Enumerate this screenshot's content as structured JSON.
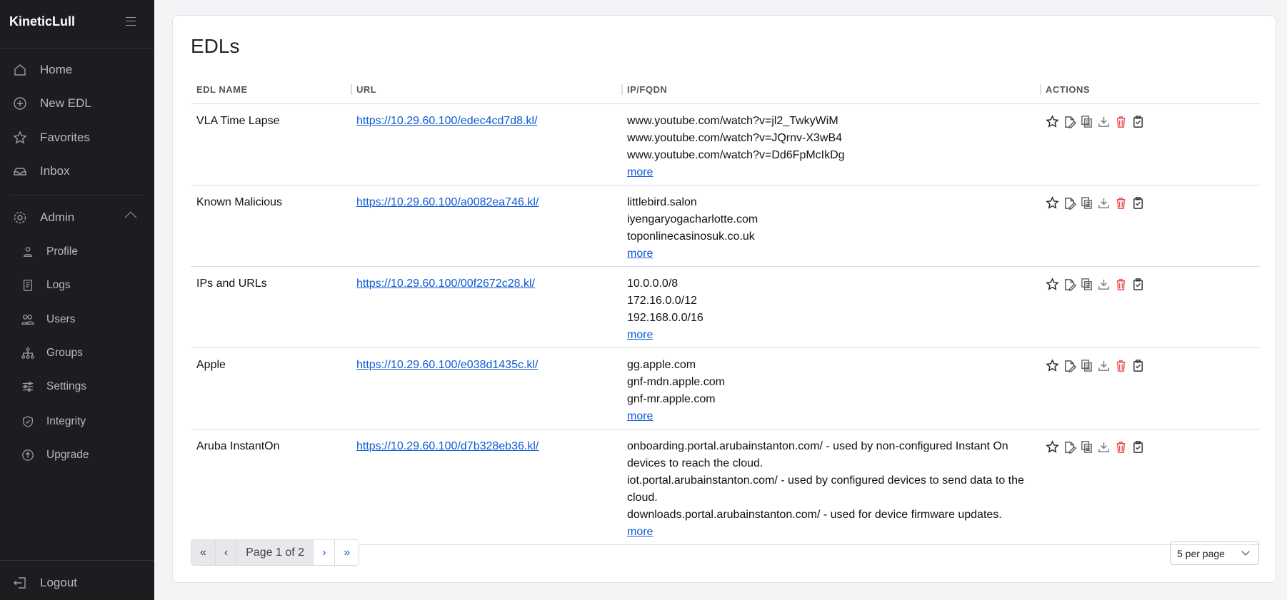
{
  "app": {
    "brand": "KineticLull"
  },
  "sidebar": {
    "items": [
      {
        "label": "Home",
        "icon": "home-icon"
      },
      {
        "label": "New EDL",
        "icon": "plus-circle-icon"
      },
      {
        "label": "Favorites",
        "icon": "star-icon"
      },
      {
        "label": "Inbox",
        "icon": "inbox-icon"
      }
    ],
    "admin": {
      "label": "Admin",
      "icon": "gear-icon"
    },
    "admin_items": [
      {
        "label": "Profile"
      },
      {
        "label": "Logs"
      },
      {
        "label": "Users"
      },
      {
        "label": "Groups"
      },
      {
        "label": "Settings"
      },
      {
        "label": "Integrity"
      },
      {
        "label": "Upgrade"
      }
    ],
    "logout": "Logout"
  },
  "main": {
    "title": "EDLs",
    "columns": [
      "EDL NAME",
      "URL",
      "IP/FQDN",
      "ACTIONS"
    ],
    "more_label": "more",
    "rows": [
      {
        "name": "VLA Time Lapse",
        "url": "https://10.29.60.100/edec4cd7d8.kl/",
        "entries": [
          "www.youtube.com/watch?v=jl2_TwkyWiM",
          "www.youtube.com/watch?v=JQrnv-X3wB4",
          "www.youtube.com/watch?v=Dd6FpMcIkDg"
        ]
      },
      {
        "name": "Known Malicious",
        "url": "https://10.29.60.100/a0082ea746.kl/",
        "entries": [
          "littlebird.salon",
          "iyengaryogacharlotte.com",
          "toponlinecasinosuk.co.uk"
        ]
      },
      {
        "name": "IPs and URLs",
        "url": "https://10.29.60.100/00f2672c28.kl/",
        "entries": [
          "10.0.0.0/8",
          "172.16.0.0/12",
          "192.168.0.0/16"
        ]
      },
      {
        "name": "Apple",
        "url": "https://10.29.60.100/e038d1435c.kl/",
        "entries": [
          "gg.apple.com",
          "gnf-mdn.apple.com",
          "gnf-mr.apple.com"
        ]
      },
      {
        "name": "Aruba InstantOn",
        "url": "https://10.29.60.100/d7b328eb36.kl/",
        "entries": [
          "onboarding.portal.arubainstanton.com/ - used by non-configured Instant On devices to reach the cloud.",
          "iot.portal.arubainstanton.com/ - used by configured devices to send data to the cloud.",
          "downloads.portal.arubainstanton.com/ - used for device firmware updates."
        ]
      }
    ],
    "pagination": {
      "first": "«",
      "prev": "‹",
      "label": "Page 1 of 2",
      "next": "›",
      "last": "»"
    },
    "per_page": "5 per page"
  },
  "colors": {
    "sidebar_bg": "#1c1d21",
    "link": "#0d5bd6",
    "delete": "#f0484f"
  }
}
